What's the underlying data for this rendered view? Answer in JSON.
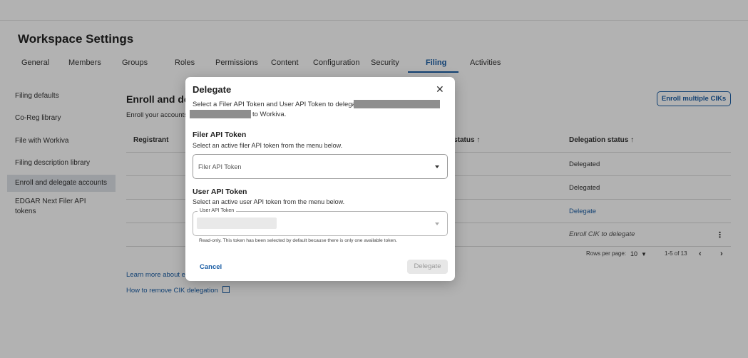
{
  "page": {
    "title": "Workspace Settings"
  },
  "tabs": [
    {
      "label": "General"
    },
    {
      "label": "Members"
    },
    {
      "label": "Groups"
    },
    {
      "label": "Roles"
    },
    {
      "label": "Permissions"
    },
    {
      "label": "Content"
    },
    {
      "label": "Configuration"
    },
    {
      "label": "Security"
    },
    {
      "label": "Filing"
    },
    {
      "label": "Activities"
    }
  ],
  "active_tab": "Filing",
  "sidebar": {
    "items": [
      {
        "label": "Filing defaults"
      },
      {
        "label": "Co-Reg library"
      },
      {
        "label": "File with Workiva"
      },
      {
        "label": "Filing description library"
      },
      {
        "label": "Enroll and delegate accounts"
      },
      {
        "label": "EDGAR Next Filer API tokens"
      }
    ],
    "active_item": "Enroll and delegate accounts"
  },
  "main": {
    "section_title": "Enroll and dele",
    "section_desc": "Enroll your accounts",
    "enroll_button": "Enroll multiple CIKs",
    "table": {
      "headers": {
        "registrant": "Registrant",
        "status_partial": "t status",
        "delegation": "Delegation status"
      },
      "sort_icon": "arrow-up-icon",
      "delegation_values": [
        "Delegated",
        "Delegated",
        "Delegate",
        "Enroll CIK to delegate"
      ]
    },
    "pagination": {
      "rows_label": "Rows per page:",
      "rows_value": "10",
      "range": "1-5 of 13"
    },
    "help_links": {
      "learn_more": "Learn more about e",
      "remove_delegation": "How to remove CIK delegation"
    }
  },
  "modal": {
    "title": "Delegate",
    "close_icon": "close-icon",
    "desc_line1": "Select a Filer API Token and User API Token to delegate",
    "desc_line2": "to Workiva.",
    "filer_heading": "Filer API Token",
    "filer_sub": "Select an active filer API token from the menu below.",
    "filer_placeholder": "Filer API Token",
    "user_heading": "User API Token",
    "user_sub": "Select an active user API token from the menu below.",
    "user_label": "User API Token",
    "user_note": "Read-only. This token has been selected by default because there is only one available token.",
    "cancel": "Cancel",
    "submit": "Delegate"
  },
  "colors": {
    "accent": "#1b5ea5",
    "redaction": "#8e8e8e"
  }
}
